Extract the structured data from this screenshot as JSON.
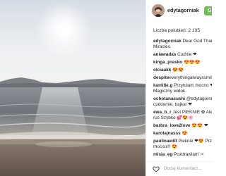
{
  "post": {
    "username": "edytagorniak",
    "follow_label": "Obserwuj",
    "likes_text": "Liczba polubień: 2 135",
    "add_comment_placeholder": "Dodaj komentarz..."
  },
  "comments": [
    {
      "lines": [
        {
          "user": "edytagorniak",
          "text": " Dear God Thank"
        },
        {
          "user": "",
          "text": "Miracles."
        }
      ]
    },
    {
      "lines": [
        {
          "user": "aniawadas",
          "text": " Cudnie ❤"
        }
      ]
    },
    {
      "lines": [
        {
          "user": "kinga_prasko",
          "text": " 😍😍😍"
        }
      ]
    },
    {
      "lines": [
        {
          "user": "olciaakk",
          "text": " 😍😍"
        }
      ]
    },
    {
      "lines": [
        {
          "user": "despite",
          "text": "everythingalwayssmile"
        }
      ]
    },
    {
      "lines": [
        {
          "user": "kamille.g",
          "text": " Przytulam mocno ❤"
        },
        {
          "user": "",
          "text": "Magiczny widok."
        }
      ]
    },
    {
      "lines": [
        {
          "user": "ochotanasushi",
          "text": " @edytagorniak"
        },
        {
          "user": "",
          "text": "cudownie, bajka! ❤"
        }
      ]
    },
    {
      "lines": [
        {
          "user": "ewa_b_r",
          "text": " Jest PIEKNIE ✿ Ale c"
        },
        {
          "user": "",
          "text": "rus Szybko 💕😍🌸"
        }
      ]
    },
    {
      "lines": [
        {
          "user": "barbra_love2love",
          "text": " 😍😍 ❤"
        }
      ]
    },
    {
      "lines": [
        {
          "user": "karolajnasss",
          "text": " 😍"
        }
      ]
    },
    {
      "lines": [
        {
          "user": "paulinaedit",
          "text": " Pieknie ❤😍 Przytul"
        },
        {
          "user": "",
          "text": "mocno!!! 😍"
        }
      ]
    },
    {
      "lines": [
        {
          "user": "misia_eg",
          "text": " Pozdrawiam :<"
        }
      ]
    }
  ],
  "colors": {
    "follow": "#70c050",
    "text": "#262626",
    "muted": "#999999"
  }
}
